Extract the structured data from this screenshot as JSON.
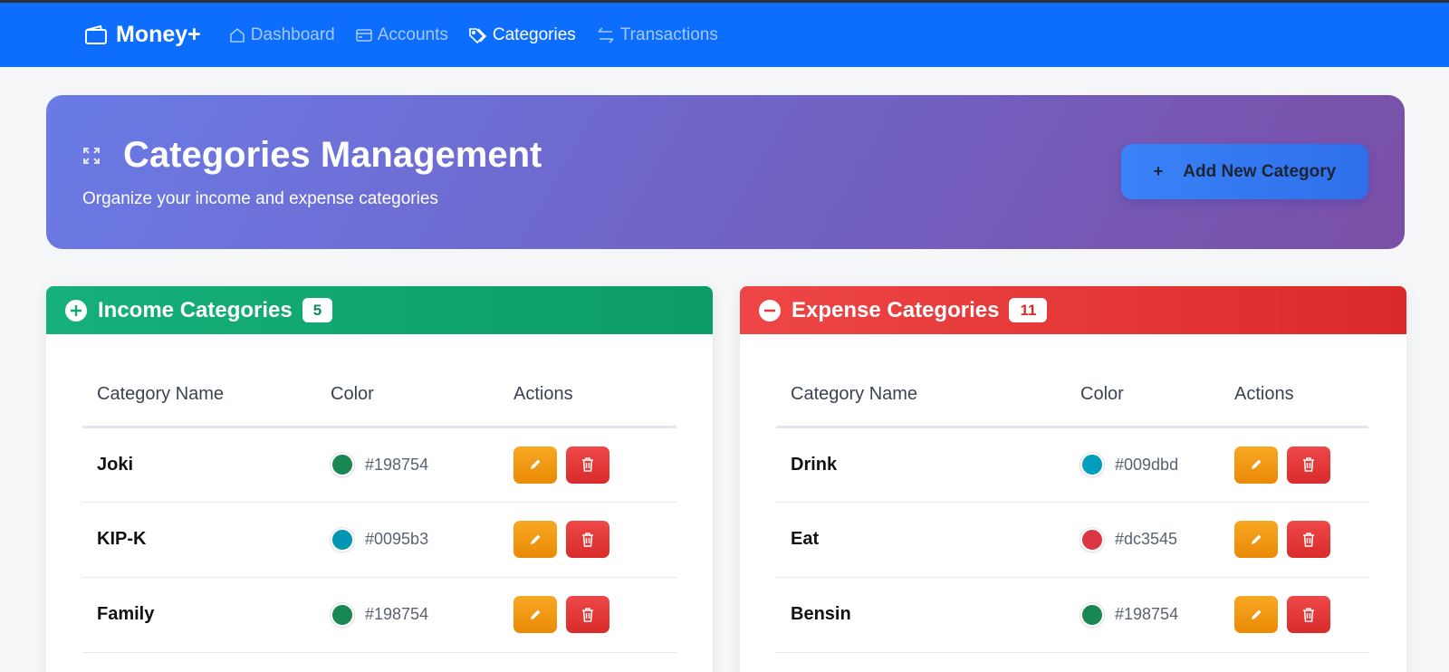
{
  "navbar": {
    "brand": "Money+",
    "links": [
      {
        "label": "Dashboard",
        "icon": "house-icon",
        "active": false
      },
      {
        "label": "Accounts",
        "icon": "card-icon",
        "active": false
      },
      {
        "label": "Categories",
        "icon": "tags-icon",
        "active": true
      },
      {
        "label": "Transactions",
        "icon": "arrows-swap-icon",
        "active": false
      }
    ]
  },
  "hero": {
    "title": "Categories Management",
    "subtitle": "Organize your income and expense categories",
    "add_button": "Add New Category",
    "add_icon": "+"
  },
  "income": {
    "title": "Income Categories",
    "count": "5",
    "columns": [
      "Category Name",
      "Color",
      "Actions"
    ],
    "rows": [
      {
        "name": "Joki",
        "color": "#198754"
      },
      {
        "name": "KIP-K",
        "color": "#0095b3"
      },
      {
        "name": "Family",
        "color": "#198754"
      }
    ]
  },
  "expense": {
    "title": "Expense Categories",
    "count": "11",
    "columns": [
      "Category Name",
      "Color",
      "Actions"
    ],
    "rows": [
      {
        "name": "Drink",
        "color": "#009dbd"
      },
      {
        "name": "Eat",
        "color": "#dc3545"
      },
      {
        "name": "Bensin",
        "color": "#198754"
      }
    ]
  },
  "colors": {
    "navbar": "#0d6efd",
    "income_header": "#10a872",
    "expense_header": "#e53838",
    "edit_button": "#f39a12",
    "delete_button": "#e33a3a"
  }
}
